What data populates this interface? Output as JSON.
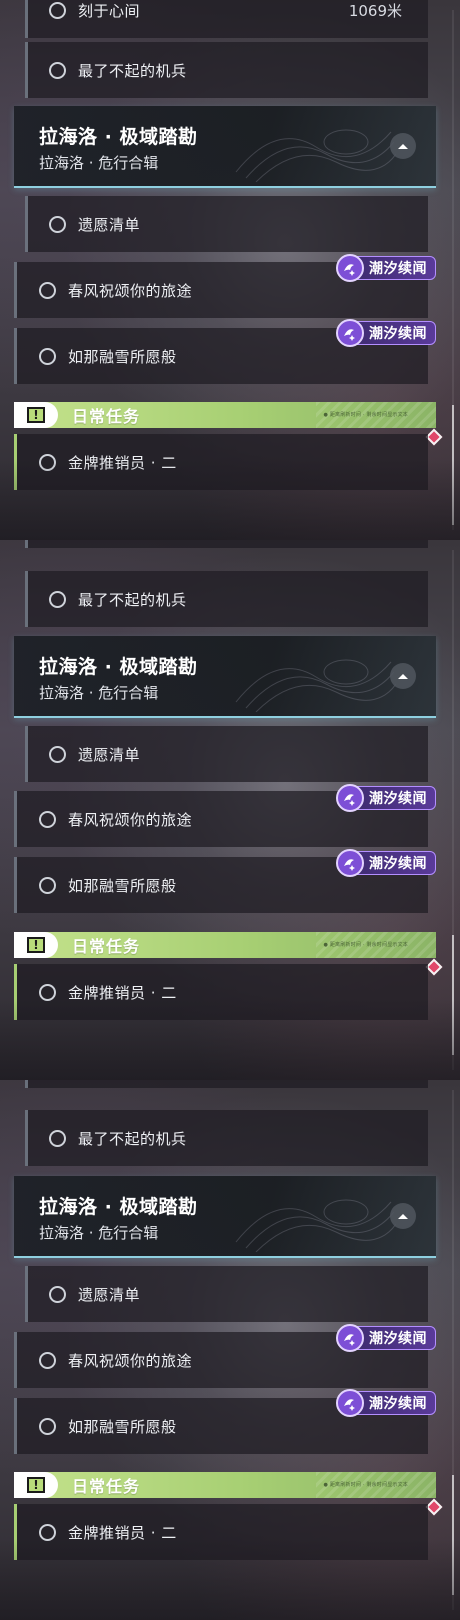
{
  "panels": [
    {
      "top_row": {
        "label": "刻于心间",
        "distance": "1069米"
      },
      "sub_row": {
        "label": "最了不起的机兵"
      },
      "header": {
        "title": "拉海洛 · 极域踏勘",
        "subtitle": "拉海洛 · 危行合辑"
      },
      "quest_1": {
        "label": "遗愿清单"
      },
      "quest_2": {
        "label": "春风祝颂你的旅途",
        "tag": "潮汐续闻"
      },
      "quest_3": {
        "label": "如那融雪所愿般",
        "tag": "潮汐续闻"
      },
      "daily": {
        "label": "日常任务",
        "tiny": "● 距离刷新时间 · 剩余时间显示文本"
      },
      "daily_quest": {
        "label": "金牌推销员 · 二"
      }
    },
    {
      "sub_row": {
        "label": "最了不起的机兵"
      },
      "header": {
        "title": "拉海洛 · 极域踏勘",
        "subtitle": "拉海洛 · 危行合辑"
      },
      "quest_1": {
        "label": "遗愿清单"
      },
      "quest_2": {
        "label": "春风祝颂你的旅途",
        "tag": "潮汐续闻"
      },
      "quest_3": {
        "label": "如那融雪所愿般",
        "tag": "潮汐续闻"
      },
      "daily": {
        "label": "日常任务",
        "tiny": "● 距离刷新时间 · 剩余时间显示文本"
      },
      "daily_quest": {
        "label": "金牌推销员 · 二"
      }
    },
    {
      "sub_row": {
        "label": "最了不起的机兵"
      },
      "header": {
        "title": "拉海洛 · 极域踏勘",
        "subtitle": "拉海洛 · 危行合辑"
      },
      "quest_1": {
        "label": "遗愿清单"
      },
      "quest_2": {
        "label": "春风祝颂你的旅途",
        "tag": "潮汐续闻"
      },
      "quest_3": {
        "label": "如那融雪所愿般",
        "tag": "潮汐续闻"
      },
      "daily": {
        "label": "日常任务",
        "tiny": "● 距离刷新时间 · 剩余时间显示文本"
      },
      "daily_quest": {
        "label": "金牌推销员 · 二"
      }
    }
  ],
  "icons": {
    "collapse": "chevron-up-icon",
    "tag": "sparkle-wave-icon",
    "alert": "exclamation-icon",
    "tracking": "diamond-marker-icon"
  },
  "colors": {
    "accent_cyan": "#8fd0e0",
    "daily_green": "#a7cf73",
    "tag_purple": "#5a3a9a",
    "marker_red": "#e0486a"
  }
}
